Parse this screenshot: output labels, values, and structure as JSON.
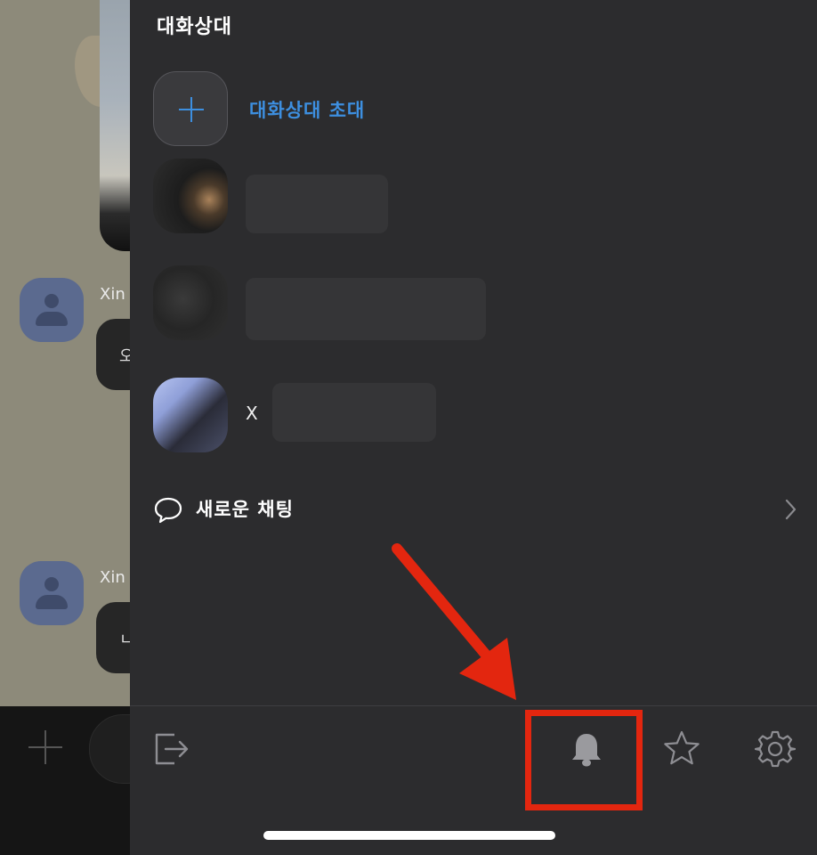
{
  "background_chat": {
    "messages": [
      {
        "sender": "Xin",
        "text": "오"
      },
      {
        "sender": "Xin",
        "text": "ㄴ"
      }
    ]
  },
  "drawer": {
    "title": "대화상대",
    "invite_label": "대화상대 초대",
    "members": [
      {
        "name": ""
      },
      {
        "name": ""
      },
      {
        "name": "X"
      }
    ],
    "new_chat_label": "새로운 채팅",
    "toolbar": {
      "icons": [
        "exit-icon",
        "bell-icon",
        "star-icon",
        "gear-icon"
      ]
    }
  },
  "annotation": {
    "highlight_color": "#e3260f",
    "accent": "#3d8fe0"
  }
}
